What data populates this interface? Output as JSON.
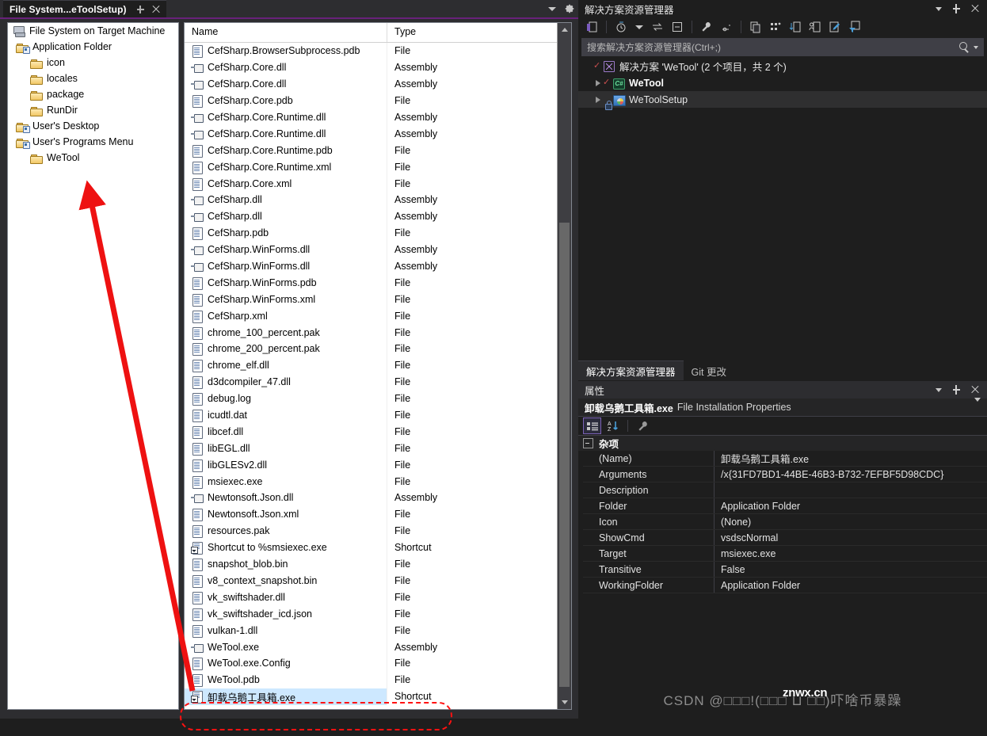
{
  "editor": {
    "tab_title": "File System...eToolSetup)",
    "pin_icon": "pin-icon",
    "close_icon": "close-icon",
    "dropdown_icon": "chevron-down-icon",
    "settings_icon": "gear-icon"
  },
  "tree": {
    "items": [
      {
        "label": "File System on Target Machine",
        "indent": 0,
        "icon": "computer-icon"
      },
      {
        "label": "Application Folder",
        "indent": 1,
        "icon": "special-folder-icon"
      },
      {
        "label": "icon",
        "indent": 2,
        "icon": "folder-icon"
      },
      {
        "label": "locales",
        "indent": 2,
        "icon": "folder-icon"
      },
      {
        "label": "package",
        "indent": 2,
        "icon": "folder-icon"
      },
      {
        "label": "RunDir",
        "indent": 2,
        "icon": "folder-icon"
      },
      {
        "label": "User's Desktop",
        "indent": 1,
        "icon": "special-folder-icon"
      },
      {
        "label": "User's Programs Menu",
        "indent": 1,
        "icon": "special-folder-icon"
      },
      {
        "label": "WeTool",
        "indent": 2,
        "icon": "folder-icon"
      }
    ]
  },
  "grid": {
    "columns": [
      "Name",
      "Type"
    ],
    "rows": [
      {
        "name": "CefSharp.BrowserSubprocess.pdb",
        "type": "File",
        "icon": "file-icon"
      },
      {
        "name": "CefSharp.Core.dll",
        "type": "Assembly",
        "icon": "assembly-icon"
      },
      {
        "name": "CefSharp.Core.dll",
        "type": "Assembly",
        "icon": "assembly-icon"
      },
      {
        "name": "CefSharp.Core.pdb",
        "type": "File",
        "icon": "file-icon"
      },
      {
        "name": "CefSharp.Core.Runtime.dll",
        "type": "Assembly",
        "icon": "assembly-icon"
      },
      {
        "name": "CefSharp.Core.Runtime.dll",
        "type": "Assembly",
        "icon": "assembly-icon"
      },
      {
        "name": "CefSharp.Core.Runtime.pdb",
        "type": "File",
        "icon": "file-icon"
      },
      {
        "name": "CefSharp.Core.Runtime.xml",
        "type": "File",
        "icon": "file-icon"
      },
      {
        "name": "CefSharp.Core.xml",
        "type": "File",
        "icon": "file-icon"
      },
      {
        "name": "CefSharp.dll",
        "type": "Assembly",
        "icon": "assembly-icon"
      },
      {
        "name": "CefSharp.dll",
        "type": "Assembly",
        "icon": "assembly-icon"
      },
      {
        "name": "CefSharp.pdb",
        "type": "File",
        "icon": "file-icon"
      },
      {
        "name": "CefSharp.WinForms.dll",
        "type": "Assembly",
        "icon": "assembly-icon"
      },
      {
        "name": "CefSharp.WinForms.dll",
        "type": "Assembly",
        "icon": "assembly-icon"
      },
      {
        "name": "CefSharp.WinForms.pdb",
        "type": "File",
        "icon": "file-icon"
      },
      {
        "name": "CefSharp.WinForms.xml",
        "type": "File",
        "icon": "file-icon"
      },
      {
        "name": "CefSharp.xml",
        "type": "File",
        "icon": "file-icon"
      },
      {
        "name": "chrome_100_percent.pak",
        "type": "File",
        "icon": "file-icon"
      },
      {
        "name": "chrome_200_percent.pak",
        "type": "File",
        "icon": "file-icon"
      },
      {
        "name": "chrome_elf.dll",
        "type": "File",
        "icon": "file-icon"
      },
      {
        "name": "d3dcompiler_47.dll",
        "type": "File",
        "icon": "file-icon"
      },
      {
        "name": "debug.log",
        "type": "File",
        "icon": "file-icon"
      },
      {
        "name": "icudtl.dat",
        "type": "File",
        "icon": "file-icon"
      },
      {
        "name": "libcef.dll",
        "type": "File",
        "icon": "file-icon"
      },
      {
        "name": "libEGL.dll",
        "type": "File",
        "icon": "file-icon"
      },
      {
        "name": "libGLESv2.dll",
        "type": "File",
        "icon": "file-icon"
      },
      {
        "name": "msiexec.exe",
        "type": "File",
        "icon": "file-icon"
      },
      {
        "name": "Newtonsoft.Json.dll",
        "type": "Assembly",
        "icon": "assembly-icon"
      },
      {
        "name": "Newtonsoft.Json.xml",
        "type": "File",
        "icon": "file-icon"
      },
      {
        "name": "resources.pak",
        "type": "File",
        "icon": "file-icon"
      },
      {
        "name": "Shortcut to %smsiexec.exe",
        "type": "Shortcut",
        "icon": "shortcut-icon"
      },
      {
        "name": "snapshot_blob.bin",
        "type": "File",
        "icon": "file-icon"
      },
      {
        "name": "v8_context_snapshot.bin",
        "type": "File",
        "icon": "file-icon"
      },
      {
        "name": "vk_swiftshader.dll",
        "type": "File",
        "icon": "file-icon"
      },
      {
        "name": "vk_swiftshader_icd.json",
        "type": "File",
        "icon": "file-icon"
      },
      {
        "name": "vulkan-1.dll",
        "type": "File",
        "icon": "file-icon"
      },
      {
        "name": "WeTool.exe",
        "type": "Assembly",
        "icon": "assembly-icon"
      },
      {
        "name": "WeTool.exe.Config",
        "type": "File",
        "icon": "file-icon"
      },
      {
        "name": "WeTool.pdb",
        "type": "File",
        "icon": "file-icon"
      },
      {
        "name": "卸载乌鹅工具箱.exe",
        "type": "Shortcut",
        "icon": "shortcut-icon",
        "selected": true
      }
    ]
  },
  "solution_explorer": {
    "title": "解决方案资源管理器",
    "search_placeholder": "搜索解决方案资源管理器(Ctrl+;)",
    "toolbar_icons": [
      "open-in-editor-icon",
      "pending-changes-icon",
      "sync-icon",
      "collapse-all-icon",
      "properties-icon",
      "show-all-files-icon",
      "copy-icon",
      "view-class-diagram-icon",
      "sort-icon",
      "preview-icon",
      "edit-icon",
      "filter-icon"
    ],
    "nodes": [
      {
        "label": "解决方案 'WeTool' (2 个项目，共 2 个)",
        "indent": 0,
        "icon": "solution-icon",
        "status": "check"
      },
      {
        "label": "WeTool",
        "indent": 1,
        "icon": "csharp-project-icon",
        "status": "check",
        "bold": true
      },
      {
        "label": "WeToolSetup",
        "indent": 1,
        "icon": "setup-project-icon",
        "status": "lock",
        "selected": true
      }
    ]
  },
  "dock_tabs": [
    {
      "label": "解决方案资源管理器",
      "active": true
    },
    {
      "label": "Git 更改",
      "active": false
    }
  ],
  "properties": {
    "title": "属性",
    "object_name": "卸载乌鹅工具箱.exe",
    "object_kind": "File Installation Properties",
    "toolbar_icons": [
      "categorized-icon",
      "alphabetical-icon",
      "property-pages-icon"
    ],
    "category": "杂项",
    "rows": [
      {
        "key": "(Name)",
        "value": "卸载乌鹅工具箱.exe"
      },
      {
        "key": "Arguments",
        "value": "/x{31FD7BD1-44BE-46B3-B732-7EFBF5D98CDC}"
      },
      {
        "key": "Description",
        "value": ""
      },
      {
        "key": "Folder",
        "value": "Application Folder"
      },
      {
        "key": "Icon",
        "value": "(None)"
      },
      {
        "key": "ShowCmd",
        "value": "vsdscNormal"
      },
      {
        "key": "Target",
        "value": "msiexec.exe"
      },
      {
        "key": "Transitive",
        "value": "False"
      },
      {
        "key": "WorkingFolder",
        "value": "Application Folder"
      }
    ]
  },
  "watermark": {
    "text": "CSDN @□□□!(□□□ ⊔ □□)吓啥币暴躁",
    "overlay": "znwx.cn"
  },
  "colors": {
    "accent": "#68217a",
    "selection": "#cde8ff",
    "annotation": "#ff1111",
    "panel_bg": "#1e1e1e"
  }
}
